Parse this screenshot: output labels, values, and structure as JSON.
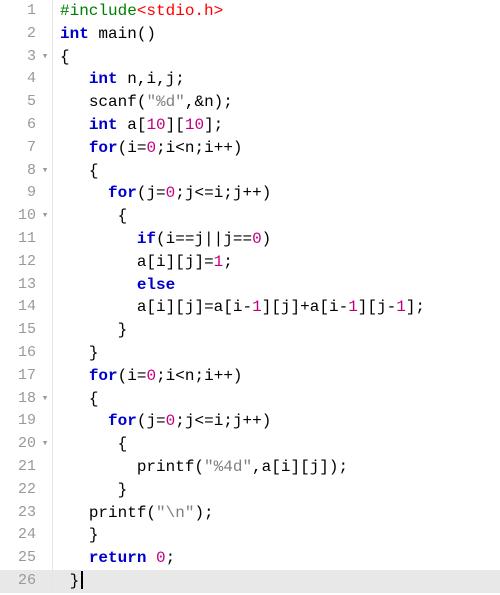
{
  "language": "c",
  "active_line": 26,
  "cursor_line": 26,
  "lines": [
    {
      "n": 1,
      "fold": "",
      "tokens": [
        [
          "pp",
          "#include"
        ],
        [
          "hdr",
          "<stdio.h>"
        ]
      ]
    },
    {
      "n": 2,
      "fold": "",
      "tokens": [
        [
          "type",
          "int"
        ],
        [
          "plain",
          " "
        ],
        [
          "fn",
          "main"
        ],
        [
          "punc",
          "()"
        ]
      ]
    },
    {
      "n": 3,
      "fold": "▾",
      "tokens": [
        [
          "punc",
          "{"
        ]
      ]
    },
    {
      "n": 4,
      "fold": "",
      "tokens": [
        [
          "plain",
          "   "
        ],
        [
          "type",
          "int"
        ],
        [
          "plain",
          " "
        ],
        [
          "id",
          "n"
        ],
        [
          "punc",
          ","
        ],
        [
          "id",
          "i"
        ],
        [
          "punc",
          ","
        ],
        [
          "id",
          "j"
        ],
        [
          "punc",
          ";"
        ]
      ]
    },
    {
      "n": 5,
      "fold": "",
      "tokens": [
        [
          "plain",
          "   "
        ],
        [
          "fn",
          "scanf"
        ],
        [
          "punc",
          "("
        ],
        [
          "str",
          "\"%d\""
        ],
        [
          "punc",
          ","
        ],
        [
          "op",
          "&"
        ],
        [
          "id",
          "n"
        ],
        [
          "punc",
          ");"
        ]
      ]
    },
    {
      "n": 6,
      "fold": "",
      "tokens": [
        [
          "plain",
          "   "
        ],
        [
          "type",
          "int"
        ],
        [
          "plain",
          " "
        ],
        [
          "id",
          "a"
        ],
        [
          "punc",
          "["
        ],
        [
          "num",
          "10"
        ],
        [
          "punc",
          "]["
        ],
        [
          "num",
          "10"
        ],
        [
          "punc",
          "];"
        ]
      ]
    },
    {
      "n": 7,
      "fold": "",
      "tokens": [
        [
          "plain",
          "   "
        ],
        [
          "kw",
          "for"
        ],
        [
          "punc",
          "("
        ],
        [
          "id",
          "i"
        ],
        [
          "op",
          "="
        ],
        [
          "num",
          "0"
        ],
        [
          "punc",
          ";"
        ],
        [
          "id",
          "i"
        ],
        [
          "op",
          "<"
        ],
        [
          "id",
          "n"
        ],
        [
          "punc",
          ";"
        ],
        [
          "id",
          "i"
        ],
        [
          "op",
          "++"
        ],
        [
          "punc",
          ")"
        ]
      ]
    },
    {
      "n": 8,
      "fold": "▾",
      "tokens": [
        [
          "plain",
          "   "
        ],
        [
          "punc",
          "{"
        ]
      ]
    },
    {
      "n": 9,
      "fold": "",
      "tokens": [
        [
          "plain",
          "     "
        ],
        [
          "kw",
          "for"
        ],
        [
          "punc",
          "("
        ],
        [
          "id",
          "j"
        ],
        [
          "op",
          "="
        ],
        [
          "num",
          "0"
        ],
        [
          "punc",
          ";"
        ],
        [
          "id",
          "j"
        ],
        [
          "op",
          "<="
        ],
        [
          "id",
          "i"
        ],
        [
          "punc",
          ";"
        ],
        [
          "id",
          "j"
        ],
        [
          "op",
          "++"
        ],
        [
          "punc",
          ")"
        ]
      ]
    },
    {
      "n": 10,
      "fold": "▾",
      "tokens": [
        [
          "plain",
          "      "
        ],
        [
          "punc",
          "{"
        ]
      ]
    },
    {
      "n": 11,
      "fold": "",
      "tokens": [
        [
          "plain",
          "        "
        ],
        [
          "kw",
          "if"
        ],
        [
          "punc",
          "("
        ],
        [
          "id",
          "i"
        ],
        [
          "op",
          "=="
        ],
        [
          "id",
          "j"
        ],
        [
          "op",
          "||"
        ],
        [
          "id",
          "j"
        ],
        [
          "op",
          "=="
        ],
        [
          "num",
          "0"
        ],
        [
          "punc",
          ")"
        ]
      ]
    },
    {
      "n": 12,
      "fold": "",
      "tokens": [
        [
          "plain",
          "        "
        ],
        [
          "id",
          "a"
        ],
        [
          "punc",
          "["
        ],
        [
          "id",
          "i"
        ],
        [
          "punc",
          "]["
        ],
        [
          "id",
          "j"
        ],
        [
          "punc",
          "]"
        ],
        [
          "op",
          "="
        ],
        [
          "num",
          "1"
        ],
        [
          "punc",
          ";"
        ]
      ]
    },
    {
      "n": 13,
      "fold": "",
      "tokens": [
        [
          "plain",
          "        "
        ],
        [
          "kw",
          "else"
        ]
      ]
    },
    {
      "n": 14,
      "fold": "",
      "tokens": [
        [
          "plain",
          "        "
        ],
        [
          "id",
          "a"
        ],
        [
          "punc",
          "["
        ],
        [
          "id",
          "i"
        ],
        [
          "punc",
          "]["
        ],
        [
          "id",
          "j"
        ],
        [
          "punc",
          "]"
        ],
        [
          "op",
          "="
        ],
        [
          "id",
          "a"
        ],
        [
          "punc",
          "["
        ],
        [
          "id",
          "i"
        ],
        [
          "op",
          "-"
        ],
        [
          "num",
          "1"
        ],
        [
          "punc",
          "]["
        ],
        [
          "id",
          "j"
        ],
        [
          "punc",
          "]"
        ],
        [
          "op",
          "+"
        ],
        [
          "id",
          "a"
        ],
        [
          "punc",
          "["
        ],
        [
          "id",
          "i"
        ],
        [
          "op",
          "-"
        ],
        [
          "num",
          "1"
        ],
        [
          "punc",
          "]["
        ],
        [
          "id",
          "j"
        ],
        [
          "op",
          "-"
        ],
        [
          "num",
          "1"
        ],
        [
          "punc",
          "];"
        ]
      ]
    },
    {
      "n": 15,
      "fold": "",
      "tokens": [
        [
          "plain",
          "      "
        ],
        [
          "punc",
          "}"
        ]
      ]
    },
    {
      "n": 16,
      "fold": "",
      "tokens": [
        [
          "plain",
          "   "
        ],
        [
          "punc",
          "}"
        ]
      ]
    },
    {
      "n": 17,
      "fold": "",
      "tokens": [
        [
          "plain",
          "   "
        ],
        [
          "kw",
          "for"
        ],
        [
          "punc",
          "("
        ],
        [
          "id",
          "i"
        ],
        [
          "op",
          "="
        ],
        [
          "num",
          "0"
        ],
        [
          "punc",
          ";"
        ],
        [
          "id",
          "i"
        ],
        [
          "op",
          "<"
        ],
        [
          "id",
          "n"
        ],
        [
          "punc",
          ";"
        ],
        [
          "id",
          "i"
        ],
        [
          "op",
          "++"
        ],
        [
          "punc",
          ")"
        ]
      ]
    },
    {
      "n": 18,
      "fold": "▾",
      "tokens": [
        [
          "plain",
          "   "
        ],
        [
          "punc",
          "{"
        ]
      ]
    },
    {
      "n": 19,
      "fold": "",
      "tokens": [
        [
          "plain",
          "     "
        ],
        [
          "kw",
          "for"
        ],
        [
          "punc",
          "("
        ],
        [
          "id",
          "j"
        ],
        [
          "op",
          "="
        ],
        [
          "num",
          "0"
        ],
        [
          "punc",
          ";"
        ],
        [
          "id",
          "j"
        ],
        [
          "op",
          "<="
        ],
        [
          "id",
          "i"
        ],
        [
          "punc",
          ";"
        ],
        [
          "id",
          "j"
        ],
        [
          "op",
          "++"
        ],
        [
          "punc",
          ")"
        ]
      ]
    },
    {
      "n": 20,
      "fold": "▾",
      "tokens": [
        [
          "plain",
          "      "
        ],
        [
          "punc",
          "{"
        ]
      ]
    },
    {
      "n": 21,
      "fold": "",
      "tokens": [
        [
          "plain",
          "        "
        ],
        [
          "fn",
          "printf"
        ],
        [
          "punc",
          "("
        ],
        [
          "str",
          "\"%4d\""
        ],
        [
          "punc",
          ","
        ],
        [
          "id",
          "a"
        ],
        [
          "punc",
          "["
        ],
        [
          "id",
          "i"
        ],
        [
          "punc",
          "]["
        ],
        [
          "id",
          "j"
        ],
        [
          "punc",
          "]);"
        ]
      ]
    },
    {
      "n": 22,
      "fold": "",
      "tokens": [
        [
          "plain",
          "      "
        ],
        [
          "punc",
          "}"
        ]
      ]
    },
    {
      "n": 23,
      "fold": "",
      "tokens": [
        [
          "plain",
          "   "
        ],
        [
          "fn",
          "printf"
        ],
        [
          "punc",
          "("
        ],
        [
          "str",
          "\"\\n\""
        ],
        [
          "punc",
          ");"
        ]
      ]
    },
    {
      "n": 24,
      "fold": "",
      "tokens": [
        [
          "plain",
          "   "
        ],
        [
          "punc",
          "}"
        ]
      ]
    },
    {
      "n": 25,
      "fold": "",
      "tokens": [
        [
          "plain",
          "   "
        ],
        [
          "kw",
          "return"
        ],
        [
          "plain",
          " "
        ],
        [
          "num",
          "0"
        ],
        [
          "punc",
          ";"
        ]
      ]
    },
    {
      "n": 26,
      "fold": "",
      "tokens": [
        [
          "plain",
          " "
        ],
        [
          "punc",
          "}"
        ]
      ]
    }
  ]
}
